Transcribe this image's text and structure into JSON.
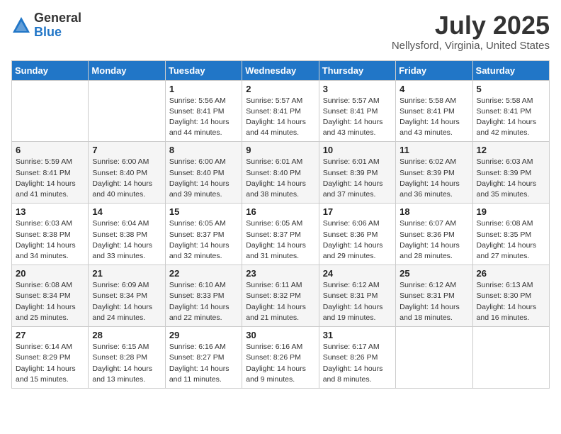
{
  "logo": {
    "general": "General",
    "blue": "Blue"
  },
  "title": "July 2025",
  "location": "Nellysford, Virginia, United States",
  "days_of_week": [
    "Sunday",
    "Monday",
    "Tuesday",
    "Wednesday",
    "Thursday",
    "Friday",
    "Saturday"
  ],
  "weeks": [
    [
      {
        "day": "",
        "info": ""
      },
      {
        "day": "",
        "info": ""
      },
      {
        "day": "1",
        "info": "Sunrise: 5:56 AM\nSunset: 8:41 PM\nDaylight: 14 hours and 44 minutes."
      },
      {
        "day": "2",
        "info": "Sunrise: 5:57 AM\nSunset: 8:41 PM\nDaylight: 14 hours and 44 minutes."
      },
      {
        "day": "3",
        "info": "Sunrise: 5:57 AM\nSunset: 8:41 PM\nDaylight: 14 hours and 43 minutes."
      },
      {
        "day": "4",
        "info": "Sunrise: 5:58 AM\nSunset: 8:41 PM\nDaylight: 14 hours and 43 minutes."
      },
      {
        "day": "5",
        "info": "Sunrise: 5:58 AM\nSunset: 8:41 PM\nDaylight: 14 hours and 42 minutes."
      }
    ],
    [
      {
        "day": "6",
        "info": "Sunrise: 5:59 AM\nSunset: 8:41 PM\nDaylight: 14 hours and 41 minutes."
      },
      {
        "day": "7",
        "info": "Sunrise: 6:00 AM\nSunset: 8:40 PM\nDaylight: 14 hours and 40 minutes."
      },
      {
        "day": "8",
        "info": "Sunrise: 6:00 AM\nSunset: 8:40 PM\nDaylight: 14 hours and 39 minutes."
      },
      {
        "day": "9",
        "info": "Sunrise: 6:01 AM\nSunset: 8:40 PM\nDaylight: 14 hours and 38 minutes."
      },
      {
        "day": "10",
        "info": "Sunrise: 6:01 AM\nSunset: 8:39 PM\nDaylight: 14 hours and 37 minutes."
      },
      {
        "day": "11",
        "info": "Sunrise: 6:02 AM\nSunset: 8:39 PM\nDaylight: 14 hours and 36 minutes."
      },
      {
        "day": "12",
        "info": "Sunrise: 6:03 AM\nSunset: 8:39 PM\nDaylight: 14 hours and 35 minutes."
      }
    ],
    [
      {
        "day": "13",
        "info": "Sunrise: 6:03 AM\nSunset: 8:38 PM\nDaylight: 14 hours and 34 minutes."
      },
      {
        "day": "14",
        "info": "Sunrise: 6:04 AM\nSunset: 8:38 PM\nDaylight: 14 hours and 33 minutes."
      },
      {
        "day": "15",
        "info": "Sunrise: 6:05 AM\nSunset: 8:37 PM\nDaylight: 14 hours and 32 minutes."
      },
      {
        "day": "16",
        "info": "Sunrise: 6:05 AM\nSunset: 8:37 PM\nDaylight: 14 hours and 31 minutes."
      },
      {
        "day": "17",
        "info": "Sunrise: 6:06 AM\nSunset: 8:36 PM\nDaylight: 14 hours and 29 minutes."
      },
      {
        "day": "18",
        "info": "Sunrise: 6:07 AM\nSunset: 8:36 PM\nDaylight: 14 hours and 28 minutes."
      },
      {
        "day": "19",
        "info": "Sunrise: 6:08 AM\nSunset: 8:35 PM\nDaylight: 14 hours and 27 minutes."
      }
    ],
    [
      {
        "day": "20",
        "info": "Sunrise: 6:08 AM\nSunset: 8:34 PM\nDaylight: 14 hours and 25 minutes."
      },
      {
        "day": "21",
        "info": "Sunrise: 6:09 AM\nSunset: 8:34 PM\nDaylight: 14 hours and 24 minutes."
      },
      {
        "day": "22",
        "info": "Sunrise: 6:10 AM\nSunset: 8:33 PM\nDaylight: 14 hours and 22 minutes."
      },
      {
        "day": "23",
        "info": "Sunrise: 6:11 AM\nSunset: 8:32 PM\nDaylight: 14 hours and 21 minutes."
      },
      {
        "day": "24",
        "info": "Sunrise: 6:12 AM\nSunset: 8:31 PM\nDaylight: 14 hours and 19 minutes."
      },
      {
        "day": "25",
        "info": "Sunrise: 6:12 AM\nSunset: 8:31 PM\nDaylight: 14 hours and 18 minutes."
      },
      {
        "day": "26",
        "info": "Sunrise: 6:13 AM\nSunset: 8:30 PM\nDaylight: 14 hours and 16 minutes."
      }
    ],
    [
      {
        "day": "27",
        "info": "Sunrise: 6:14 AM\nSunset: 8:29 PM\nDaylight: 14 hours and 15 minutes."
      },
      {
        "day": "28",
        "info": "Sunrise: 6:15 AM\nSunset: 8:28 PM\nDaylight: 14 hours and 13 minutes."
      },
      {
        "day": "29",
        "info": "Sunrise: 6:16 AM\nSunset: 8:27 PM\nDaylight: 14 hours and 11 minutes."
      },
      {
        "day": "30",
        "info": "Sunrise: 6:16 AM\nSunset: 8:26 PM\nDaylight: 14 hours and 9 minutes."
      },
      {
        "day": "31",
        "info": "Sunrise: 6:17 AM\nSunset: 8:26 PM\nDaylight: 14 hours and 8 minutes."
      },
      {
        "day": "",
        "info": ""
      },
      {
        "day": "",
        "info": ""
      }
    ]
  ]
}
